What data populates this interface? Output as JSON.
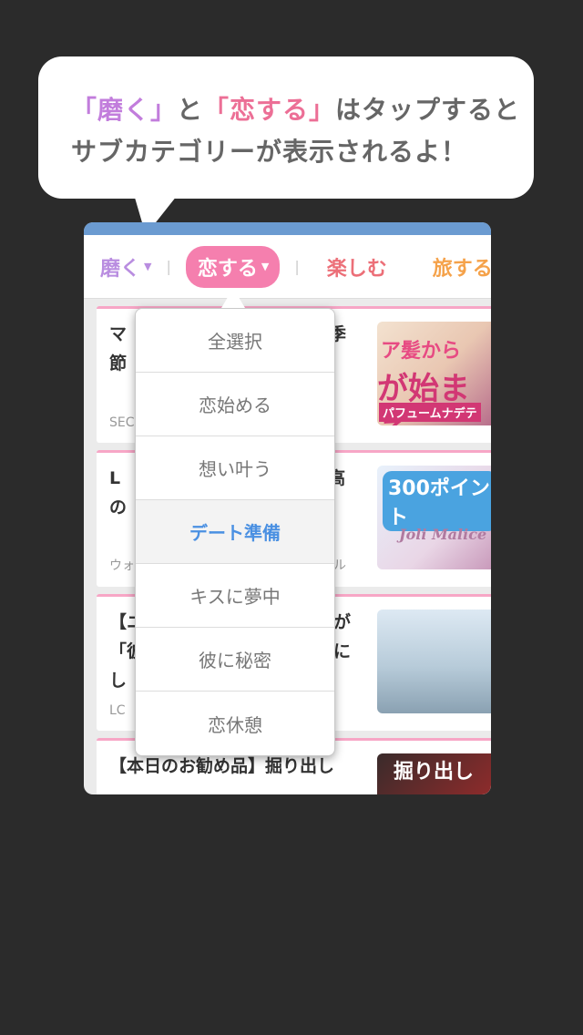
{
  "bubble": {
    "line1_q1": "「磨く」",
    "line1_to": "と",
    "line1_q2": "「恋する」",
    "line1_rest": "はタップすると",
    "line2": "サブカテゴリーが表示されるよ！"
  },
  "nav": {
    "categories": [
      {
        "label": "磨く",
        "arrow": "▼"
      },
      {
        "label": "恋する",
        "arrow": "▼"
      },
      {
        "label": "楽しむ"
      },
      {
        "label": "旅する"
      }
    ],
    "separator": "|"
  },
  "dropdown": {
    "items": [
      "全選択",
      "恋始める",
      "想い叶う",
      "デート準備",
      "キスに夢中",
      "彼に秘密",
      "恋休憩"
    ],
    "selected": "デート準備"
  },
  "feed": {
    "cards": [
      {
        "title_left": "マ",
        "title_right": "季",
        "title_left2": "節",
        "title_right2": "…",
        "source": "SEC",
        "thumb_text": [
          "ア髪から",
          "が始まる",
          "パフュームナデテ"
        ]
      },
      {
        "title_left": "L",
        "title_right": "高",
        "title_left2": "の",
        "title_right2": "",
        "source": "ウォ",
        "source_right": "ル",
        "thumb_text": [
          "300ポイント",
          "Joli Malice"
        ]
      },
      {
        "title_left": "【ニ",
        "title_right": "が",
        "title_left2": "「彼",
        "title_right2": "に",
        "title_left3": "し",
        "source": "LC",
        "thumb_text": []
      },
      {
        "title": "【本日のお勧め品】掘り出し",
        "thumb_text": [
          "掘り出し"
        ]
      }
    ]
  },
  "colors": {
    "background": "#2b2b2b",
    "purple": "#c27ddc",
    "pink": "#ec6f96",
    "selected_blue": "#4a90e2",
    "nav_pill": "#f57fae",
    "topbar": "#6b9bd1"
  }
}
